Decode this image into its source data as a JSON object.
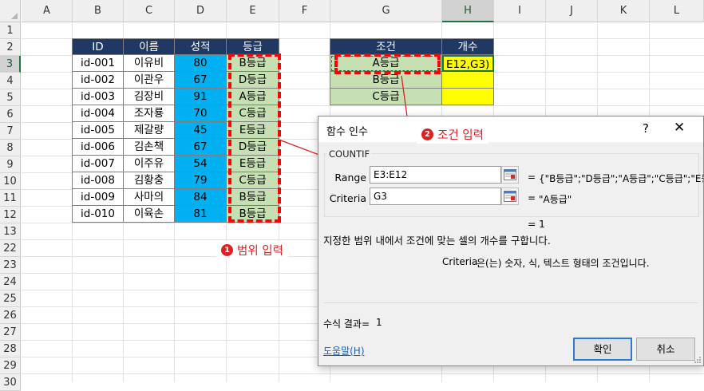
{
  "columns": [
    "A",
    "B",
    "C",
    "D",
    "E",
    "F",
    "G",
    "H",
    "I",
    "J",
    "K",
    "L"
  ],
  "rows": [
    "1",
    "2",
    "3",
    "4",
    "5",
    "6",
    "7",
    "8",
    "9",
    "10",
    "11",
    "12",
    "13",
    "22",
    "23",
    "24",
    "25",
    "26",
    "27",
    "28",
    "29",
    "30"
  ],
  "table": {
    "headers": [
      "ID",
      "이름",
      "성적",
      "등급"
    ],
    "ids": [
      "id-001",
      "id-002",
      "id-003",
      "id-004",
      "id-005",
      "id-006",
      "id-007",
      "id-008",
      "id-009",
      "id-010"
    ],
    "names": [
      "이유비",
      "이관우",
      "김장비",
      "조자룡",
      "제갈량",
      "김손책",
      "이주유",
      "김황충",
      "사마의",
      "이육손"
    ],
    "scores": [
      "80",
      "67",
      "91",
      "70",
      "45",
      "67",
      "54",
      "79",
      "84",
      "81"
    ],
    "grades": [
      "B등급",
      "D등급",
      "A등급",
      "C등급",
      "E등급",
      "D등급",
      "E등급",
      "C등급",
      "B등급",
      "B등급"
    ]
  },
  "summary": {
    "headers": [
      "조건",
      "개수"
    ],
    "conditions": [
      "A등급",
      "B등급",
      "C등급"
    ],
    "counts": [
      "E12,G3)",
      "",
      ""
    ]
  },
  "annotations": {
    "range": {
      "num": "1",
      "text": "범위 입력"
    },
    "criteria": {
      "num": "2",
      "text": "조건 입력"
    }
  },
  "dialog": {
    "title": "함수 인수",
    "help": "?",
    "close": "✕",
    "function_name": "COUNTIF",
    "args": [
      {
        "label": "Range",
        "value": "E3:E12",
        "result": "{\"B등급\";\"D등급\";\"A등급\";\"C등급\";\"E등"
      },
      {
        "label": "Criteria",
        "value": "G3",
        "result": "\"A등급\""
      }
    ],
    "eq": "=",
    "result_line": "1",
    "description": "지정한 범위 내에서 조건에 맞는 셀의 개수를 구합니다.",
    "arg_desc_name": "Criteria",
    "arg_desc_text": "은(는) 숫자, 식, 텍스트 형태의 조건입니다.",
    "formula_result_label": "수식 결과=",
    "formula_result_value": "1",
    "help_link": "도움말(H)",
    "ok": "확인",
    "cancel": "취소"
  },
  "colors": {
    "header_navy": "#1f3864",
    "score_cyan": "#00b0f0",
    "grade_green": "#c6e0b4",
    "count_yellow": "#ffff00",
    "annotation_red": "#e02020"
  }
}
